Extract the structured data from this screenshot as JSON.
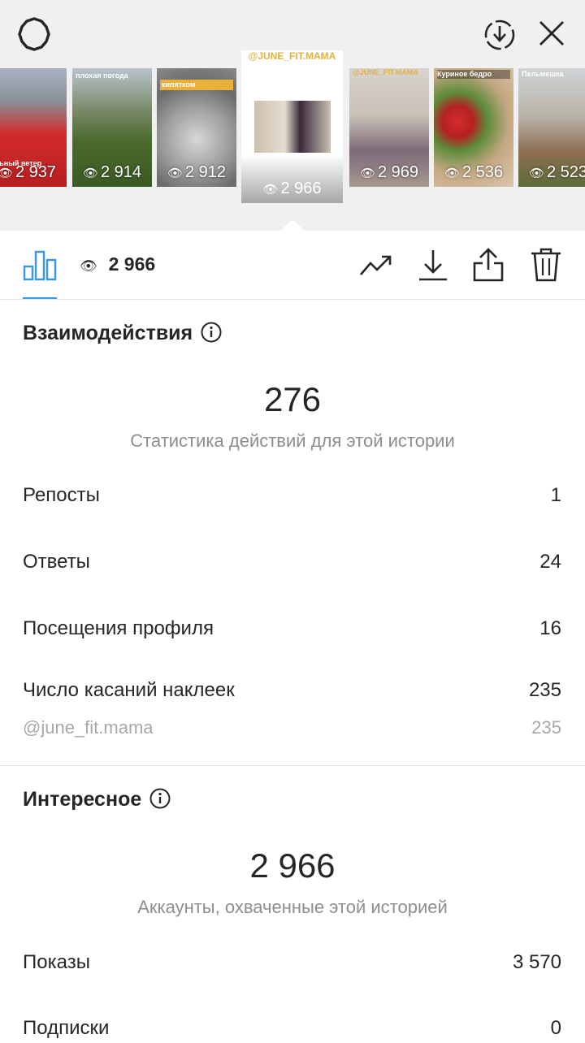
{
  "story_strip": {
    "thumbs": [
      {
        "views": "2 937",
        "caption": "ильный ветер"
      },
      {
        "views": "2 914",
        "caption": "плохая погода"
      },
      {
        "views": "2 912",
        "caption": "кипятком"
      },
      {
        "views": "2 969",
        "caption": "@JUNE_FIT.MAMA"
      },
      {
        "views": "2 536",
        "caption": "Куриное бедро"
      },
      {
        "views": "2 523",
        "caption": "Пельмешка"
      }
    ],
    "active": {
      "handle": "@JUNE_FIT.MAMA",
      "views": "2 966"
    }
  },
  "toolbar": {
    "views": "2 966"
  },
  "interactions": {
    "title": "Взаимодействия",
    "total": "276",
    "subtitle": "Статистика действий для этой истории",
    "rows": [
      {
        "label": "Репосты",
        "value": "1"
      },
      {
        "label": "Ответы",
        "value": "24"
      },
      {
        "label": "Посещения профиля",
        "value": "16"
      },
      {
        "label": "Число касаний наклеек",
        "value": "235"
      }
    ],
    "sticker": {
      "label": "@june_fit.mama",
      "value": "235"
    }
  },
  "discovery": {
    "title": "Интересное",
    "total": "2 966",
    "subtitle": "Аккаунты, охваченные этой историей",
    "rows": [
      {
        "label": "Показы",
        "value": "3 570"
      },
      {
        "label": "Подписки",
        "value": "0"
      }
    ]
  },
  "colors": {
    "accent": "#3897f0",
    "text": "#262626",
    "muted": "#8e8e8e"
  },
  "icons": [
    "settings-icon",
    "download-circle-icon",
    "close-icon",
    "bar-chart-icon",
    "eye-icon",
    "trend-icon",
    "download-icon",
    "share-icon",
    "trash-icon",
    "info-icon"
  ]
}
